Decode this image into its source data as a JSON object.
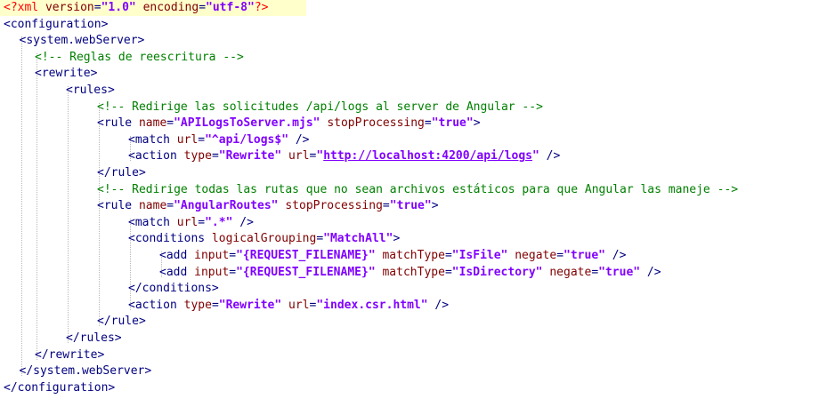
{
  "lines": [
    [
      {
        "c": "decl",
        "t": "<?xml "
      },
      {
        "c": "attr",
        "t": "version"
      },
      {
        "c": "tag",
        "t": "="
      },
      {
        "c": "val",
        "t": "\"1.0\""
      },
      {
        "c": "tag",
        "t": " "
      },
      {
        "c": "attr",
        "t": "encoding"
      },
      {
        "c": "tag",
        "t": "="
      },
      {
        "c": "val",
        "t": "\"utf-8\""
      },
      {
        "c": "decl",
        "t": "?>"
      }
    ],
    [
      {
        "c": "tag",
        "t": "<configuration>"
      }
    ],
    [
      {
        "c": "tag",
        "t": "<system.webServer>"
      }
    ],
    [
      {
        "c": "comment",
        "t": "<!-- Reglas de reescritura -->"
      }
    ],
    [
      {
        "c": "tag",
        "t": "<rewrite>"
      }
    ],
    [
      {
        "c": "tag",
        "t": "<rules>"
      }
    ],
    [
      {
        "c": "comment",
        "t": "<!-- Redirige las solicitudes /api/logs al server de Angular -->"
      }
    ],
    [
      {
        "c": "tag",
        "t": "<rule "
      },
      {
        "c": "attr",
        "t": "name"
      },
      {
        "c": "tag",
        "t": "="
      },
      {
        "c": "val",
        "t": "\"APILogsToServer.mjs\""
      },
      {
        "c": "tag",
        "t": " "
      },
      {
        "c": "attr",
        "t": "stopProcessing"
      },
      {
        "c": "tag",
        "t": "="
      },
      {
        "c": "val",
        "t": "\"true\""
      },
      {
        "c": "tag",
        "t": ">"
      }
    ],
    [
      {
        "c": "tag",
        "t": "<match "
      },
      {
        "c": "attr",
        "t": "url"
      },
      {
        "c": "tag",
        "t": "="
      },
      {
        "c": "val",
        "t": "\"^api/logs$\""
      },
      {
        "c": "tag",
        "t": " />"
      }
    ],
    [
      {
        "c": "tag",
        "t": "<action "
      },
      {
        "c": "attr",
        "t": "type"
      },
      {
        "c": "tag",
        "t": "="
      },
      {
        "c": "val",
        "t": "\"Rewrite\""
      },
      {
        "c": "tag",
        "t": " "
      },
      {
        "c": "attr",
        "t": "url"
      },
      {
        "c": "tag",
        "t": "="
      },
      {
        "c": "val",
        "t": "\""
      },
      {
        "c": "val link",
        "t": "http://localhost:4200/api/logs"
      },
      {
        "c": "val",
        "t": "\""
      },
      {
        "c": "tag",
        "t": " />"
      }
    ],
    [
      {
        "c": "tag",
        "t": "</rule>"
      }
    ],
    [
      {
        "c": "comment",
        "t": "<!-- Redirige todas las rutas que no sean archivos estáticos para que Angular las maneje -->"
      }
    ],
    [
      {
        "c": "tag",
        "t": "<rule "
      },
      {
        "c": "attr",
        "t": "name"
      },
      {
        "c": "tag",
        "t": "="
      },
      {
        "c": "val",
        "t": "\"AngularRoutes\""
      },
      {
        "c": "tag",
        "t": " "
      },
      {
        "c": "attr",
        "t": "stopProcessing"
      },
      {
        "c": "tag",
        "t": "="
      },
      {
        "c": "val",
        "t": "\"true\""
      },
      {
        "c": "tag",
        "t": ">"
      }
    ],
    [
      {
        "c": "tag",
        "t": "<match "
      },
      {
        "c": "attr",
        "t": "url"
      },
      {
        "c": "tag",
        "t": "="
      },
      {
        "c": "val",
        "t": "\".*\""
      },
      {
        "c": "tag",
        "t": " />"
      }
    ],
    [
      {
        "c": "tag",
        "t": "<conditions "
      },
      {
        "c": "attr",
        "t": "logicalGrouping"
      },
      {
        "c": "tag",
        "t": "="
      },
      {
        "c": "val",
        "t": "\"MatchAll\""
      },
      {
        "c": "tag",
        "t": ">"
      }
    ],
    [
      {
        "c": "tag",
        "t": "<add "
      },
      {
        "c": "attr",
        "t": "input"
      },
      {
        "c": "tag",
        "t": "="
      },
      {
        "c": "val",
        "t": "\"{REQUEST_FILENAME}\""
      },
      {
        "c": "tag",
        "t": " "
      },
      {
        "c": "attr",
        "t": "matchType"
      },
      {
        "c": "tag",
        "t": "="
      },
      {
        "c": "val",
        "t": "\"IsFile\""
      },
      {
        "c": "tag",
        "t": " "
      },
      {
        "c": "attr",
        "t": "negate"
      },
      {
        "c": "tag",
        "t": "="
      },
      {
        "c": "val",
        "t": "\"true\""
      },
      {
        "c": "tag",
        "t": " />"
      }
    ],
    [
      {
        "c": "tag",
        "t": "<add "
      },
      {
        "c": "attr",
        "t": "input"
      },
      {
        "c": "tag",
        "t": "="
      },
      {
        "c": "val",
        "t": "\"{REQUEST_FILENAME}\""
      },
      {
        "c": "tag",
        "t": " "
      },
      {
        "c": "attr",
        "t": "matchType"
      },
      {
        "c": "tag",
        "t": "="
      },
      {
        "c": "val",
        "t": "\"IsDirectory\""
      },
      {
        "c": "tag",
        "t": " "
      },
      {
        "c": "attr",
        "t": "negate"
      },
      {
        "c": "tag",
        "t": "="
      },
      {
        "c": "val",
        "t": "\"true\""
      },
      {
        "c": "tag",
        "t": " />"
      }
    ],
    [
      {
        "c": "tag",
        "t": "</conditions>"
      }
    ],
    [
      {
        "c": "tag",
        "t": "<action "
      },
      {
        "c": "attr",
        "t": "type"
      },
      {
        "c": "tag",
        "t": "="
      },
      {
        "c": "val",
        "t": "\"Rewrite\""
      },
      {
        "c": "tag",
        "t": " "
      },
      {
        "c": "attr",
        "t": "url"
      },
      {
        "c": "tag",
        "t": "="
      },
      {
        "c": "val",
        "t": "\"index.csr.html\""
      },
      {
        "c": "tag",
        "t": " />"
      }
    ],
    [
      {
        "c": "tag",
        "t": "</rule>"
      }
    ],
    [
      {
        "c": "tag",
        "t": "</rules>"
      }
    ],
    [
      {
        "c": "tag",
        "t": "</rewrite>"
      }
    ],
    [
      {
        "c": "tag",
        "t": "</system.webServer>"
      }
    ],
    [
      {
        "c": "tag",
        "t": "</configuration>"
      }
    ]
  ]
}
